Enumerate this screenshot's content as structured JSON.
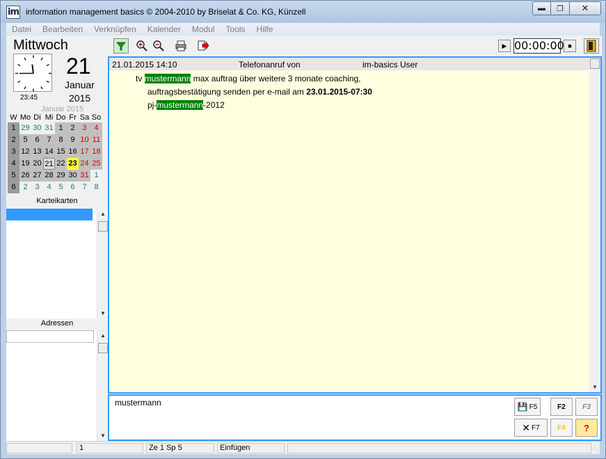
{
  "window": {
    "title": "information management basics  © 2004-2010 by Briselat & Co. KG, Künzell",
    "app_icon_text": "im"
  },
  "menu": [
    "Datei",
    "Bearbeiten",
    "Verknüpfen",
    "Kalender",
    "Modul",
    "Tools",
    "Hilfe"
  ],
  "date_panel": {
    "weekday": "Mittwoch",
    "day": "21",
    "month": "Januar",
    "year": "2015",
    "clock_time": "23:45",
    "clock": {
      "hour": 11,
      "minute": 45
    }
  },
  "calendar": {
    "month_label": "Januar 2015",
    "headers": [
      "W",
      "Mo",
      "Di",
      "Mi",
      "Do",
      "Fr",
      "Sa",
      "So"
    ],
    "weeks": [
      {
        "week": "1",
        "days": [
          "29",
          "30",
          "31",
          "1",
          "2",
          "3",
          "4"
        ],
        "kinds": [
          "o",
          "o",
          "o",
          "m",
          "m",
          "w",
          "w"
        ]
      },
      {
        "week": "2",
        "days": [
          "5",
          "6",
          "7",
          "8",
          "9",
          "10",
          "11"
        ],
        "kinds": [
          "m",
          "m",
          "m",
          "m",
          "m",
          "w",
          "w"
        ]
      },
      {
        "week": "3",
        "days": [
          "12",
          "13",
          "14",
          "15",
          "16",
          "17",
          "18"
        ],
        "kinds": [
          "m",
          "m",
          "m",
          "m",
          "m",
          "w",
          "w"
        ]
      },
      {
        "week": "4",
        "days": [
          "19",
          "20",
          "21",
          "22",
          "23",
          "24",
          "25"
        ],
        "kinds": [
          "m",
          "m",
          "s",
          "m",
          "t",
          "w",
          "w"
        ]
      },
      {
        "week": "5",
        "days": [
          "26",
          "27",
          "28",
          "29",
          "30",
          "31",
          "1"
        ],
        "kinds": [
          "m",
          "m",
          "m",
          "m",
          "m",
          "w",
          "ow"
        ]
      },
      {
        "week": "6",
        "days": [
          "2",
          "3",
          "4",
          "5",
          "6",
          "7",
          "8"
        ],
        "kinds": [
          "o",
          "o",
          "o",
          "o",
          "o",
          "o",
          "o"
        ]
      }
    ]
  },
  "karteikarten": {
    "title": "Karteikarten"
  },
  "adressen": {
    "title": "Adressen",
    "value": ""
  },
  "toolbar": {
    "icons": [
      "filter-icon",
      "zoom-in-icon",
      "zoom-out-icon",
      "print-icon",
      "export-icon"
    ],
    "timer": "00:00:00"
  },
  "note": {
    "date": "21.01.2015 14:10",
    "type": "Telefonanruf von",
    "user": "im-basics User",
    "line1_pre": "tv ",
    "line1_hl": "mustermann",
    "line1_post": " max auftrag über weitere 3 monate coaching,",
    "line2_pre": "auftragsbestätigung senden per e-mail am ",
    "line2_bold": "23.01.2015-07:30",
    "line3_pre": "pj-",
    "line3_hl": "mustermann",
    "line3_post": "-2012"
  },
  "search": {
    "text": "mustermann",
    "btn_f5": "F5",
    "btn_f2": "F2",
    "btn_f3": "F3",
    "btn_f7": "F7",
    "btn_f4": "F4",
    "btn_help": "?"
  },
  "status": {
    "field1": "1",
    "field2": "Ze 1  Sp 5",
    "field3": "Einfügen"
  },
  "colors": {
    "highlight": "#008000",
    "focus_border": "#3399ff",
    "note_bg": "#ffffe0",
    "weekend": "#d40000",
    "today": "#ffff40"
  }
}
